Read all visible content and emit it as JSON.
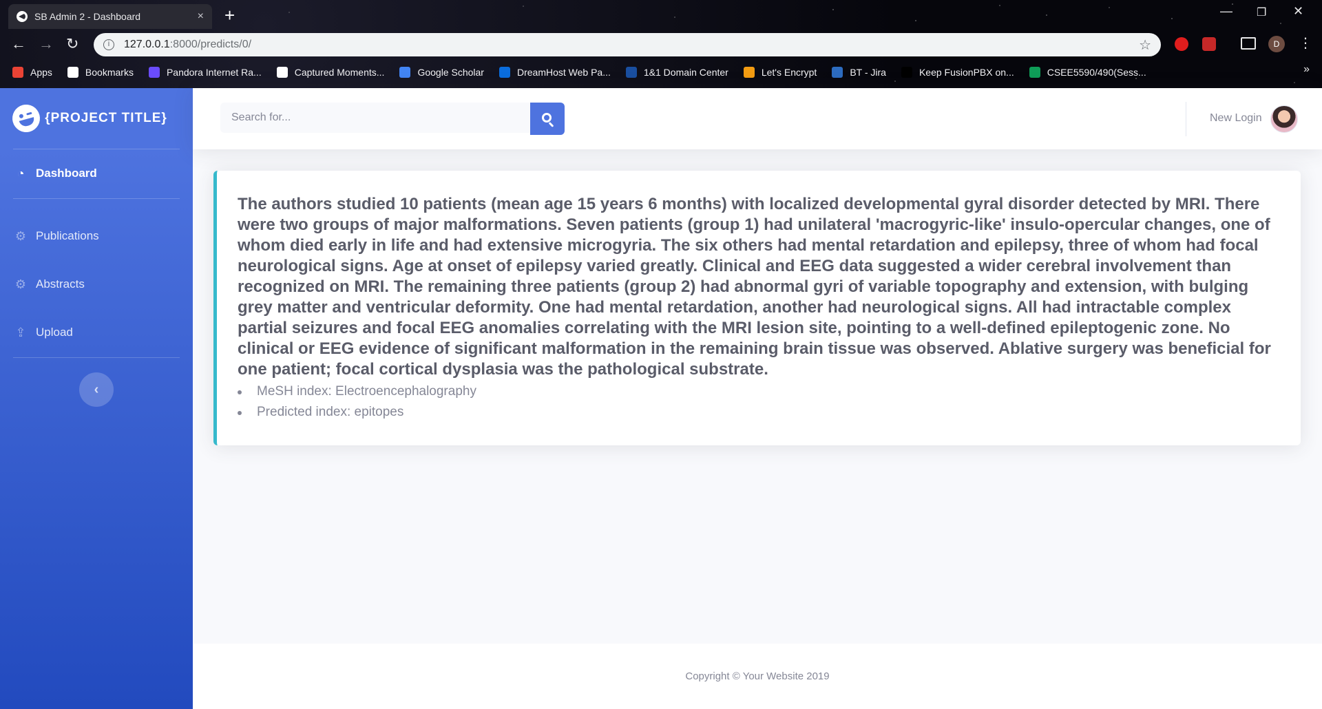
{
  "browser": {
    "tab_title": "SB Admin 2 - Dashboard",
    "tab_close": "×",
    "new_tab": "+",
    "window": {
      "minimize": "—",
      "maximize": "❐",
      "close": "✕"
    },
    "url_host": "127.0.0.1",
    "url_path": ":8000/predicts/0/",
    "profile_initial": "D",
    "bookmarks": [
      {
        "label": "Apps",
        "icon": "apps-grid-icon",
        "color": "#ea4335"
      },
      {
        "label": "Bookmarks",
        "icon": "star-icon",
        "color": "#ffffff"
      },
      {
        "label": "Pandora Internet Ra...",
        "icon": "pandora-icon",
        "color": "#6a4cff"
      },
      {
        "label": "Captured Moments...",
        "icon": "globe-icon",
        "color": "#ffffff"
      },
      {
        "label": "Google Scholar",
        "icon": "scholar-icon",
        "color": "#4285f4"
      },
      {
        "label": "DreamHost Web Pa...",
        "icon": "dreamhost-icon",
        "color": "#0a6dde"
      },
      {
        "label": "1&1 Domain Center",
        "icon": "oneandone-icon",
        "color": "#1a4fa0"
      },
      {
        "label": "Let's Encrypt",
        "icon": "letsencrypt-icon",
        "color": "#f39c12"
      },
      {
        "label": "BT - Jira",
        "icon": "jira-icon",
        "color": "#2d6cc0"
      },
      {
        "label": "Keep FusionPBX on...",
        "icon": "blank-page-icon",
        "color": "#000000"
      },
      {
        "label": "CSEE5590/490(Sess...",
        "icon": "sheets-icon",
        "color": "#0f9d58"
      }
    ]
  },
  "sidebar": {
    "brand": "{PROJECT TITLE}",
    "items": [
      {
        "label": "Dashboard",
        "icon": "tachometer-icon",
        "active": true
      },
      {
        "label": "Publications",
        "icon": "cog-icon",
        "active": false
      },
      {
        "label": "Abstracts",
        "icon": "cog-icon",
        "active": false
      },
      {
        "label": "Upload",
        "icon": "upload-icon",
        "active": false
      }
    ],
    "toggle": "‹"
  },
  "topbar": {
    "search_placeholder": "Search for...",
    "user_name": "New Login"
  },
  "card": {
    "abstract": "The authors studied 10 patients (mean age 15 years 6 months) with localized developmental gyral disorder detected by MRI. There were two groups of major malformations. Seven patients (group 1) had unilateral 'macrogyric-like' insulo-opercular changes, one of whom died early in life and had extensive microgyria. The six others had mental retardation and epilepsy, three of whom had focal neurological signs. Age at onset of epilepsy varied greatly. Clinical and EEG data suggested a wider cerebral involvement than recognized on MRI. The remaining three patients (group 2) had abnormal gyri of variable topography and extension, with bulging grey matter and ventricular deformity. One had mental retardation, another had neurological signs. All had intractable complex partial seizures and focal EEG anomalies correlating with the MRI lesion site, pointing to a well-defined epileptogenic zone. No clinical or EEG evidence of significant malformation in the remaining brain tissue was observed. Ablative surgery was beneficial for one patient; focal cortical dysplasia was the pathological substrate.",
    "mesh_index": "MeSH index: Electroencephalography",
    "predicted_index": "Predicted index: epitopes"
  },
  "footer": {
    "copyright": "Copyright © Your Website 2019"
  },
  "colors": {
    "primary": "#4e73df",
    "primary_dark": "#224abe",
    "info_border": "#36b9cc",
    "text_gray": "#858796",
    "text_dark": "#5a5c69"
  }
}
